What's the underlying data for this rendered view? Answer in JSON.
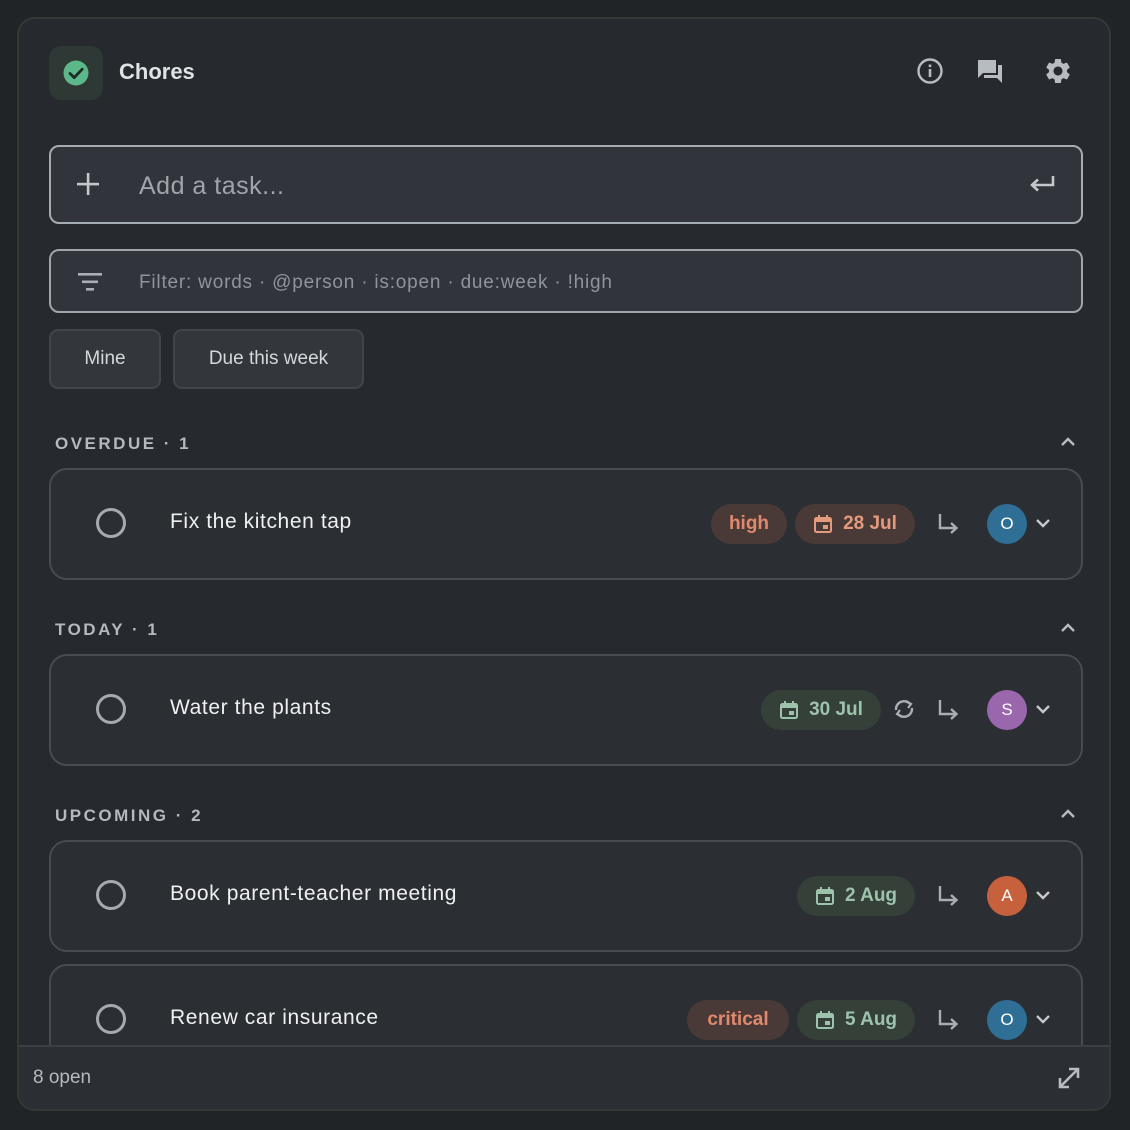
{
  "header": {
    "title": "Chores",
    "app_icon": "check-circle-icon",
    "buttons": [
      "info-icon",
      "chat-icon",
      "gear-icon"
    ]
  },
  "add_task": {
    "placeholder": "Add a task...",
    "value": ""
  },
  "filter": {
    "placeholder": "Filter: words · @person · is:open · due:week · !high",
    "value": ""
  },
  "chips": [
    {
      "label": "Mine"
    },
    {
      "label": "Due this week"
    }
  ],
  "sections": [
    {
      "title": "OVERDUE · 1",
      "tasks": [
        {
          "title": "Fix the kitchen tap",
          "priority": "high",
          "due": "28 Jul",
          "avatar": "O",
          "avatar_color": "#2f6f95",
          "overdue": true
        }
      ]
    },
    {
      "title": "TODAY · 1",
      "tasks": [
        {
          "title": "Water the plants",
          "due": "30 Jul",
          "repeat": true,
          "avatar": "S",
          "avatar_color": "#9a67ad"
        }
      ]
    },
    {
      "title": "UPCOMING · 2",
      "tasks": [
        {
          "title": "Book parent-teacher meeting",
          "due": "2 Aug",
          "avatar": "A",
          "avatar_color": "#c7613d"
        },
        {
          "title": "Renew car insurance",
          "priority": "critical",
          "due": "5 Aug",
          "avatar": "O",
          "avatar_color": "#2f6f95"
        }
      ]
    }
  ],
  "footer": {
    "count": "8 open"
  },
  "colors": {
    "accent": "#5cb88a",
    "card_bg": "#26292d",
    "overdue": "#e0896c",
    "due": "#9dc3ad"
  }
}
